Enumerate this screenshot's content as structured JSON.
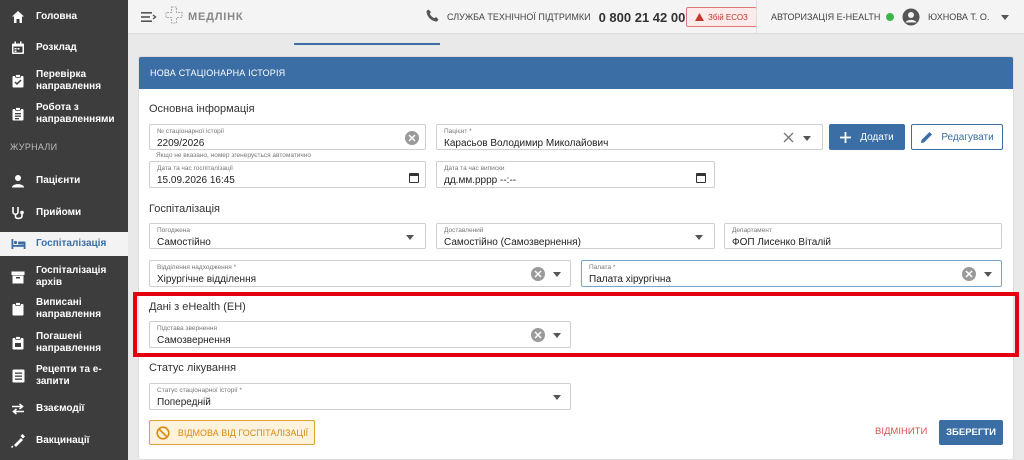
{
  "sidebar": {
    "items": [
      {
        "label": "Головна",
        "icon": "home-icon"
      },
      {
        "label": "Розклад",
        "icon": "calendar-icon"
      },
      {
        "label": "Перевірка направлення",
        "icon": "clipboard-check-icon"
      },
      {
        "label": "Робота з направленнями",
        "icon": "clipboard-list-icon"
      }
    ],
    "section_label": "ЖУРНАЛИ",
    "journal_items": [
      {
        "label": "Пацієнти",
        "icon": "person-icon"
      },
      {
        "label": "Прийоми",
        "icon": "stethoscope-icon"
      },
      {
        "label": "Госпіталізація",
        "icon": "bed-icon",
        "active": true
      },
      {
        "label": "Госпіталізація архів",
        "icon": "archive-icon"
      },
      {
        "label": "Виписані направлення",
        "icon": "clipboard-icon"
      },
      {
        "label": "Погашені направлення",
        "icon": "clipboard-done-icon"
      },
      {
        "label": "Рецепти та е-запити",
        "icon": "list-icon"
      },
      {
        "label": "Взаємодії",
        "icon": "swap-icon"
      },
      {
        "label": "Вакцинації",
        "icon": "syringe-icon"
      }
    ]
  },
  "header": {
    "logo_text": "МЕДЛІНК",
    "support_label": "СЛУЖБА ТЕХНІЧНОЇ ПІДТРИМКИ",
    "support_phone": "0 800 21 42 00",
    "esoz_alert": "Збій ЕСОЗ",
    "ehealth_label": "АВТОРИЗАЦІЯ E-HEALTH",
    "ehealth_status_color": "#3cb54a",
    "user_name": "ЮХНОВА Т. О."
  },
  "card": {
    "title": "НОВА СТАЦІОНАРНА ІСТОРІЯ",
    "basic_section": "Основна інформація",
    "history_number": {
      "label": "№ стаціонарної історії",
      "value": "2209/2026"
    },
    "history_hint": "Якщо не вказано, номер згенерується автоматично",
    "patient": {
      "label": "Пацієнт *",
      "value": "Карасьов Володимир Миколайович"
    },
    "add_button": "Додати",
    "edit_button": "Редагувати",
    "hosp_datetime": {
      "label": "Дата та час госпіталізації",
      "value": "15.09.2026 16:45"
    },
    "discharge_datetime": {
      "label": "Дата та час виписки",
      "value": "дд.мм.рррр --:--"
    },
    "hosp_section": "Госпіталізація",
    "referral": {
      "label": "Погоджена",
      "value": "Самостійно"
    },
    "delivered": {
      "label": "Доставлений",
      "value": "Самостійно (Самозвернення)"
    },
    "department": {
      "label": "Департамент",
      "value": "ФОП Лисенко Віталій"
    },
    "admission_dept": {
      "label": "Відділення надходження *",
      "value": "Хірургічне відділення"
    },
    "ward": {
      "label": "Палата *",
      "value": "Палата хірургічна"
    },
    "ehealth_section": "Дані з eHealth (ЕН)",
    "appeal_basis": {
      "label": "Підстава звернення",
      "value": "Самозвернення"
    },
    "status_section": "Статус лікування",
    "history_status": {
      "label": "Статус стаціонарної історії *",
      "value": "Попередній"
    },
    "refuse_button": "ВІДМОВА ВІД ГОСПІТАЛІЗАЦІЇ",
    "cancel_button": "ВІДМІНИТИ",
    "save_button": "ЗБЕРЕГТИ"
  },
  "colors": {
    "accent": "#3a6ea5",
    "sidebar": "#3d3d3d",
    "highlight": "#e3000f",
    "warning": "#e0a23b"
  }
}
